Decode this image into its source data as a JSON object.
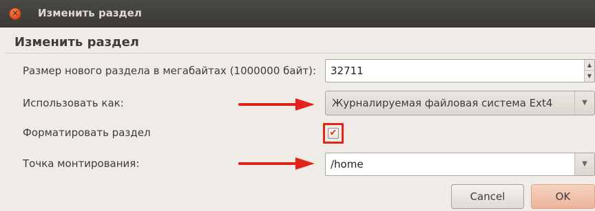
{
  "window": {
    "title": "Изменить раздел",
    "close_glyph": "✕"
  },
  "dialog": {
    "heading": "Изменить раздел",
    "size_label": "Размер нового раздела в мегабайтах (1000000 байт):",
    "size_value": "32711",
    "use_as_label": "Использовать как:",
    "use_as_value": "Журналируемая файловая система Ext4",
    "format_label": "Форматировать раздел",
    "format_checked": true,
    "format_check_glyph": "✔",
    "mount_label": "Точка монтирования:",
    "mount_value": "/home",
    "dropdown_glyph": "▼",
    "spin_up_glyph": "▲",
    "spin_down_glyph": "▼"
  },
  "buttons": {
    "cancel": "Cancel",
    "ok": "OK"
  },
  "annotation_color": "#e2231a"
}
